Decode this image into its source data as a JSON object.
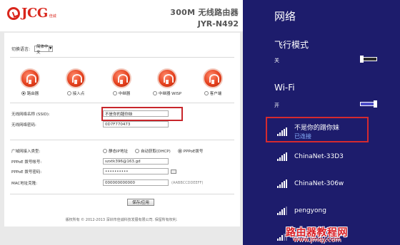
{
  "router": {
    "logo_text": "JCG",
    "logo_sub": "佳诚",
    "title": "300M 无线路由器",
    "model": "JYR-N492",
    "language": {
      "label": "切换语言:",
      "value": "简体中文"
    },
    "modes": [
      {
        "label": "路由器",
        "selected": true
      },
      {
        "label": "接入点",
        "selected": false
      },
      {
        "label": "中继器",
        "selected": false
      },
      {
        "label": "中继器 WISP",
        "selected": false
      },
      {
        "label": "客户端",
        "selected": false
      }
    ],
    "ssid": {
      "label": "无线网络名称 (SSID):",
      "value": "不是你的蹭你妹"
    },
    "wifi_password": {
      "label": "无线网络密码:",
      "value": "0D7F770473"
    },
    "wan": {
      "label": "广域网接入类型:",
      "options": [
        {
          "label": "静态IP地址",
          "selected": false
        },
        {
          "label": "自动获取(DHCP)",
          "selected": false
        },
        {
          "label": "PPPoE拨号",
          "selected": true
        }
      ]
    },
    "pppoe_account": {
      "label": "PPPoE 拨号帐号:",
      "value": "szxtk396@163.gd"
    },
    "pppoe_password": {
      "label": "PPPoE 拨号密码:",
      "value": "••••••••••"
    },
    "mac_clone": {
      "label": "MAC地址克隆:",
      "value": "000000000000",
      "hint": "(AABBCCDDEEFF)"
    },
    "save_label": "保存/应用",
    "copyright": "版权所有 © 2012-2013 深圳市佳诚科技发展有限公司. 保留所有权利."
  },
  "netpane": {
    "title": "网络",
    "airplane": {
      "label": "飞行模式",
      "state": "关"
    },
    "wifi": {
      "label": "Wi-Fi",
      "state": "开"
    },
    "networks": [
      {
        "name": "不是你的蹭你妹",
        "status": "已连接",
        "signal": "full"
      },
      {
        "name": "ChinaNet-33D3",
        "status": "",
        "signal": "full"
      },
      {
        "name": "ChinaNet-306w",
        "status": "",
        "signal": "full"
      },
      {
        "name": "pengyong",
        "status": "",
        "signal": "weak"
      },
      {
        "name": "qwzh",
        "status": "",
        "signal": "weaker"
      }
    ]
  },
  "watermark": {
    "text": "路由器教程网",
    "url": "www.jmqy.com"
  },
  "colors": {
    "accent_red": "#d52a2f",
    "pane_bg": "#1d1c6c",
    "connected": "#8ab4ff"
  }
}
